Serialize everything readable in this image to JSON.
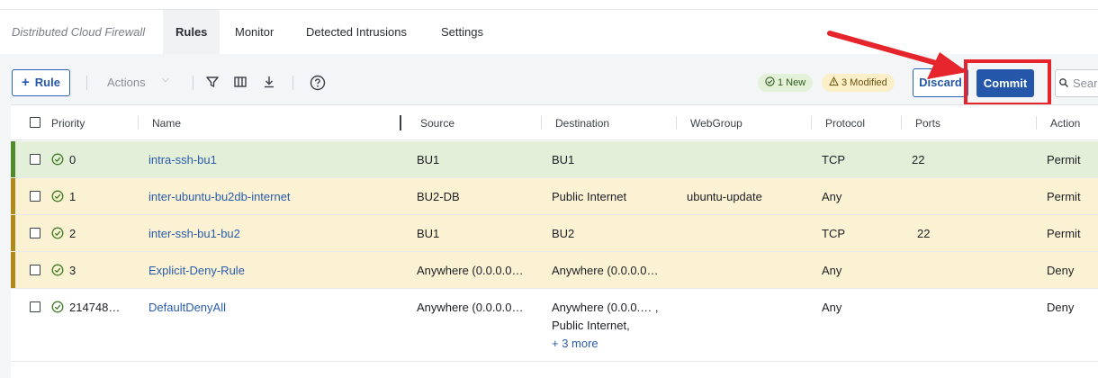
{
  "app": {
    "name": "Distributed Cloud Firewall",
    "tabs": [
      {
        "label": "Rules",
        "active": true
      },
      {
        "label": "Monitor",
        "active": false
      },
      {
        "label": "Detected Intrusions",
        "active": false
      },
      {
        "label": "Settings",
        "active": false
      }
    ]
  },
  "toolbar": {
    "add_rule_label": "Rule",
    "actions_label": "Actions",
    "badge_new": "1 New",
    "badge_modified": "3 Modified",
    "discard_label": "Discard",
    "commit_label": "Commit",
    "search_placeholder": "Search"
  },
  "table": {
    "headers": [
      "Priority",
      "Name",
      "Source",
      "Destination",
      "WebGroup",
      "Protocol",
      "Ports",
      "Action"
    ],
    "rows": [
      {
        "priority": "0",
        "name": "intra-ssh-bu1",
        "source": "BU1",
        "destination": "BU1",
        "destination2": "",
        "destination3": "",
        "webgroup": "",
        "protocol": "TCP",
        "ports": "22",
        "action": "Permit",
        "state": "new"
      },
      {
        "priority": "1",
        "name": "inter-ubuntu-bu2db-internet",
        "source": "BU2-DB",
        "destination": "Public Internet",
        "destination2": "",
        "destination3": "",
        "webgroup": "ubuntu-update",
        "protocol": "Any",
        "ports": "",
        "action": "Permit",
        "state": "modified"
      },
      {
        "priority": "2",
        "name": "inter-ssh-bu1-bu2",
        "source": "BU1",
        "destination": "BU2",
        "destination2": "",
        "destination3": "",
        "webgroup": "",
        "protocol": "TCP",
        "ports": "22",
        "action": "Permit",
        "state": "modified"
      },
      {
        "priority": "3",
        "name": "Explicit-Deny-Rule",
        "source": "Anywhere (0.0.0.0…",
        "destination": "Anywhere (0.0.0.0…",
        "destination2": "",
        "destination3": "",
        "webgroup": "",
        "protocol": "Any",
        "ports": "",
        "action": "Deny",
        "state": "modified"
      },
      {
        "priority": "214748…",
        "name": "DefaultDenyAll",
        "source": "Anywhere (0.0.0.0…",
        "destination": "Anywhere (0.0.0.… ,",
        "destination2": "Public Internet,",
        "destination3": "+ 3 more",
        "webgroup": "",
        "protocol": "Any",
        "ports": "",
        "action": "Deny",
        "state": "none"
      }
    ]
  },
  "colors": {
    "accent": "#2456aa",
    "row_new_bg": "#e3efd9",
    "row_new_bar": "#4f8a2b",
    "row_modified_bg": "#fbf1d3",
    "row_modified_bar": "#b0891a",
    "highlight": "#e5242b"
  }
}
